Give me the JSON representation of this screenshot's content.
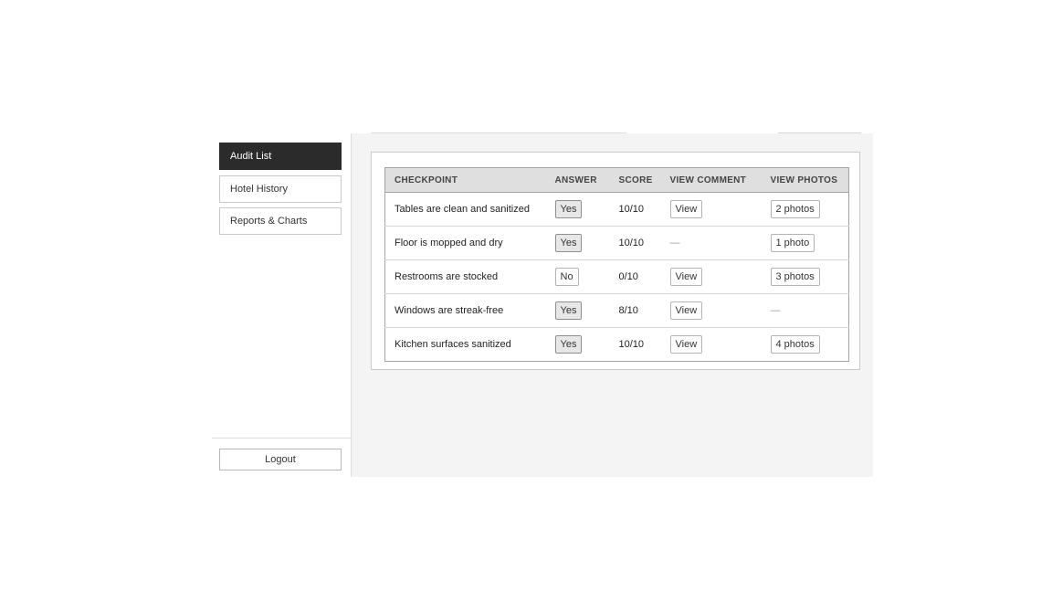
{
  "colors": {
    "active_item_bg": "#2b2b2b",
    "active_item_text": "#ffffff",
    "main_background": "#f4f4f4",
    "table_header_bg": "#dfdfdf",
    "card_border": "#cbcbcb"
  },
  "sidebar": {
    "items": [
      {
        "label": "Audit List",
        "active": true
      },
      {
        "label": "Hotel History",
        "active": false
      },
      {
        "label": "Reports & Charts",
        "active": false
      }
    ],
    "logout_label": "Logout"
  },
  "table": {
    "columns": [
      "CHECKPOINT",
      "ANSWER",
      "SCORE",
      "VIEW COMMENT",
      "VIEW PHOTOS"
    ],
    "empty_placeholder": "—",
    "rows": [
      {
        "checkpoint": "Tables are clean and sanitized",
        "answer": "Yes",
        "score": "10/10",
        "comment": "View",
        "photos": "2 photos"
      },
      {
        "checkpoint": "Floor is mopped and dry",
        "answer": "Yes",
        "score": "10/10",
        "comment": null,
        "photos": "1 photo"
      },
      {
        "checkpoint": "Restrooms are stocked",
        "answer": "No",
        "score": "0/10",
        "comment": "View",
        "photos": "3 photos"
      },
      {
        "checkpoint": "Windows are streak-free",
        "answer": "Yes",
        "score": "8/10",
        "comment": "View",
        "photos": null
      },
      {
        "checkpoint": "Kitchen surfaces sanitized",
        "answer": "Yes",
        "score": "10/10",
        "comment": "View",
        "photos": "4 photos"
      }
    ]
  }
}
